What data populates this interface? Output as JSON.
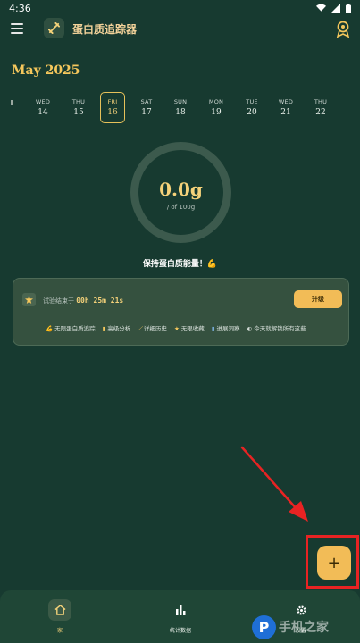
{
  "status_bar": {
    "time": "4:36"
  },
  "app_bar": {
    "title": "蛋白质追踪器"
  },
  "calendar": {
    "month_label": "May 2025",
    "days": [
      {
        "name": "WED",
        "num": "14"
      },
      {
        "name": "THU",
        "num": "15"
      },
      {
        "name": "FRI",
        "num": "16",
        "selected": true
      },
      {
        "name": "SAT",
        "num": "17"
      },
      {
        "name": "SUN",
        "num": "18"
      },
      {
        "name": "MON",
        "num": "19"
      },
      {
        "name": "TUE",
        "num": "20"
      },
      {
        "name": "WED",
        "num": "21"
      },
      {
        "name": "THU",
        "num": "22"
      }
    ]
  },
  "progress": {
    "value_label": "0.0g",
    "goal_label": "/ of 100g",
    "fraction": 0.0
  },
  "motto": "保持蛋白质能量！💪",
  "trial": {
    "prefix": "试验结束于",
    "time_left": "00h 25m 21s",
    "upgrade_label": "升级",
    "features": [
      {
        "icon": "💪",
        "label": "无限蛋白质追踪"
      },
      {
        "icon": "▮",
        "label": "高级分析"
      },
      {
        "icon": "⟋",
        "label": "详细历史"
      },
      {
        "icon": "★",
        "label": "无限收藏"
      },
      {
        "icon": "▮",
        "label": "进展洞察"
      },
      {
        "icon": "◐",
        "label": "今天就解锁所有这些"
      }
    ]
  },
  "fab": {
    "label": "+"
  },
  "bottom_nav": {
    "items": [
      {
        "label": "家",
        "active": true
      },
      {
        "label": "统计数据",
        "active": false
      },
      {
        "label": "设置",
        "active": false
      }
    ]
  },
  "watermark": {
    "letter": "P",
    "text": "手机之家"
  },
  "colors": {
    "background": "#173a30",
    "accent": "#f2bc57",
    "highlight": "#e82323"
  }
}
